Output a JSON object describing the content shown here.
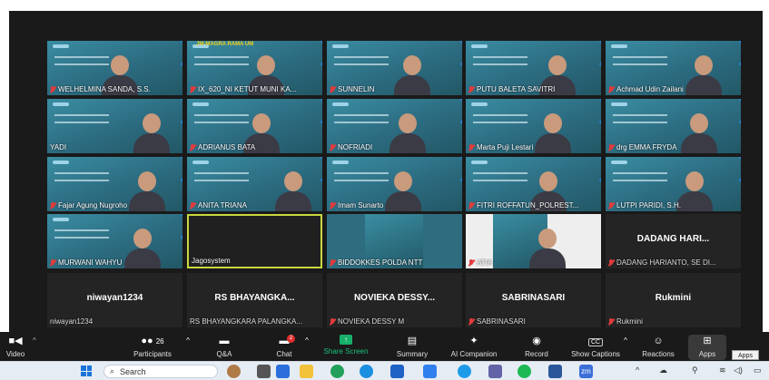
{
  "participants": [
    {
      "name": "WELHELMINA SANDA, S.S.",
      "kind": "video",
      "muted": true
    },
    {
      "name": "IX_620_NI KETUT MUNI KA...",
      "kind": "video",
      "muted": true,
      "banner": "JM-MAGRA RAMA UM"
    },
    {
      "name": "SUNNELIN",
      "kind": "video",
      "muted": true
    },
    {
      "name": "PUTU BALETA SAVITRI",
      "kind": "video",
      "muted": true
    },
    {
      "name": "Achmad Udin Zailani",
      "kind": "video",
      "muted": true
    },
    {
      "name": "YADI",
      "kind": "video",
      "muted": false
    },
    {
      "name": "ADRIANUS BATA",
      "kind": "video",
      "muted": true
    },
    {
      "name": "NOFRIADI",
      "kind": "video",
      "muted": true
    },
    {
      "name": "Marta Puji Lestari",
      "kind": "video",
      "muted": true
    },
    {
      "name": "drg EMMA FRYDA",
      "kind": "video",
      "muted": true
    },
    {
      "name": "Fajar Agung Nugroho",
      "kind": "video",
      "muted": true
    },
    {
      "name": "ANITA TRIANA",
      "kind": "video",
      "muted": true
    },
    {
      "name": "Imam Sunarto",
      "kind": "video",
      "muted": true
    },
    {
      "name": "FITRI ROFFATUN_POLREST...",
      "kind": "video",
      "muted": true
    },
    {
      "name": "LUTPI PARIDI, S.H.",
      "kind": "video",
      "muted": true
    },
    {
      "name": "MURWANI WAHYU",
      "kind": "video",
      "muted": true
    },
    {
      "name": "Jagosystem",
      "kind": "active",
      "muted": false
    },
    {
      "name": "BIDDOKKES POLDA NTT",
      "kind": "partial",
      "muted": true
    },
    {
      "name": "ATIA",
      "kind": "atia",
      "muted": true
    },
    {
      "name": "DADANG HARIANTO, SE DI...",
      "kind": "dark",
      "muted": true,
      "big": "DADANG HARI..."
    },
    {
      "name": "niwayan1234",
      "kind": "dark",
      "muted": false,
      "big": "niwayan1234"
    },
    {
      "name": "RS BHAYANGKARA PALANGKA...",
      "kind": "dark",
      "muted": false,
      "big": "RS BHAYANGKA..."
    },
    {
      "name": "NOVIEKA DESSY M",
      "kind": "dark",
      "muted": true,
      "big": "NOVIEKA DESSY..."
    },
    {
      "name": "SABRINASARI",
      "kind": "dark",
      "muted": true,
      "big": "SABRINASARI"
    },
    {
      "name": "Rukmini",
      "kind": "dark",
      "muted": true,
      "big": "Rukmini"
    }
  ],
  "toolbar": {
    "video": "Video",
    "participants": "Participants",
    "participants_count": "26",
    "qa": "Q&A",
    "chat": "Chat",
    "chat_badge": "2",
    "share": "Share Screen",
    "summary": "Summary",
    "ai": "AI Companion",
    "record": "Record",
    "captions": "Show Captions",
    "cc_icon": "CC",
    "reactions": "Reactions",
    "apps": "Apps",
    "apps_tooltip": "Apps"
  },
  "taskbar": {
    "search_placeholder": "Search",
    "icons": [
      "windows-start-icon",
      "search-icon",
      "widgets-icon",
      "task-view-icon",
      "file-explorer-icon",
      "teams-icon",
      "edge-icon",
      "store-icon",
      "meet-icon",
      "chrome-icon",
      "teams-chat-icon",
      "spotify-icon",
      "word-icon",
      "zoom-icon"
    ],
    "zoom_label": "zm"
  },
  "colors": {
    "accent_green": "#17b06b",
    "mute_red": "#e23b3b",
    "active_border": "#c8d840"
  }
}
